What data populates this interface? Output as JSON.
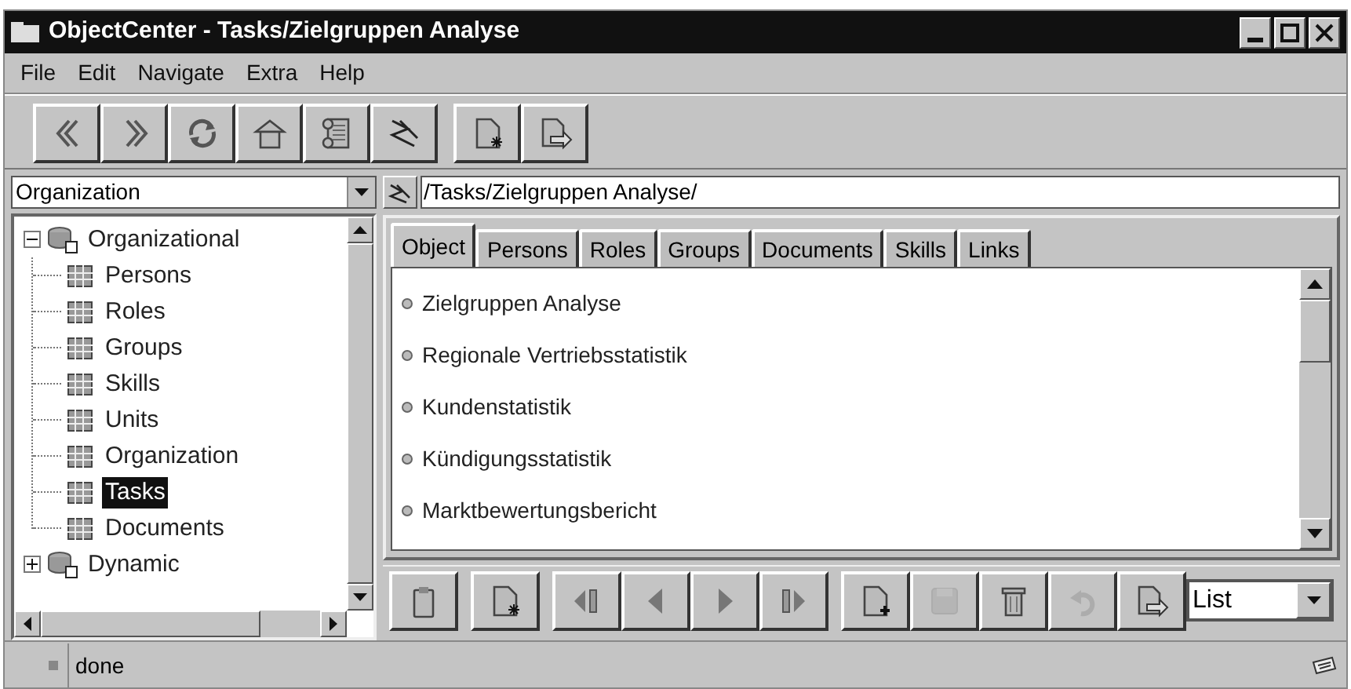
{
  "window": {
    "title": "ObjectCenter  - Tasks/Zielgruppen Analyse"
  },
  "menu": [
    "File",
    "Edit",
    "Navigate",
    "Extra",
    "Help"
  ],
  "toolbar": [
    {
      "kind": "back"
    },
    {
      "kind": "forward"
    },
    {
      "kind": "refresh"
    },
    {
      "kind": "home"
    },
    {
      "kind": "scroll"
    },
    {
      "kind": "path"
    },
    {
      "kind": "new"
    },
    {
      "kind": "export"
    }
  ],
  "location": {
    "value": "Organization"
  },
  "tree": [
    {
      "label": "Organizational",
      "kind": "group",
      "expanded": true,
      "selected": false,
      "children": [
        {
          "label": "Persons",
          "kind": "table",
          "selected": false
        },
        {
          "label": "Roles",
          "kind": "table",
          "selected": false
        },
        {
          "label": "Groups",
          "kind": "table",
          "selected": false
        },
        {
          "label": "Skills",
          "kind": "table",
          "selected": false
        },
        {
          "label": "Units",
          "kind": "table",
          "selected": false
        },
        {
          "label": "Organization",
          "kind": "table",
          "selected": false
        },
        {
          "label": "Tasks",
          "kind": "table",
          "selected": true
        },
        {
          "label": "Documents",
          "kind": "table",
          "selected": false
        }
      ]
    },
    {
      "label": "Dynamic",
      "kind": "group",
      "expanded": false,
      "selected": false
    }
  ],
  "path": {
    "value": "/Tasks/Zielgruppen Analyse/"
  },
  "tabs": [
    {
      "label": "Object",
      "selected": true
    },
    {
      "label": "Persons",
      "selected": false
    },
    {
      "label": "Roles",
      "selected": false
    },
    {
      "label": "Groups",
      "selected": false
    },
    {
      "label": "Documents",
      "selected": false
    },
    {
      "label": "Skills",
      "selected": false
    },
    {
      "label": "Links",
      "selected": false
    }
  ],
  "items": [
    "Zielgruppen Analyse",
    "Regionale Vertriebsstatistik",
    "Kundenstatistik",
    "Kündigungsstatistik",
    "Marktbewertungsbericht"
  ],
  "bottom_toolbar": [
    {
      "kind": "clipboard",
      "disabled": false
    },
    {
      "kind": "new",
      "disabled": false
    },
    {
      "kind": "first",
      "disabled": false
    },
    {
      "kind": "previous",
      "disabled": false
    },
    {
      "kind": "next",
      "disabled": false
    },
    {
      "kind": "last",
      "disabled": false
    },
    {
      "kind": "add",
      "disabled": false
    },
    {
      "kind": "save",
      "disabled": true
    },
    {
      "kind": "delete",
      "disabled": false
    },
    {
      "kind": "undo",
      "disabled": true
    },
    {
      "kind": "export",
      "disabled": false
    }
  ],
  "view": {
    "value": "List"
  },
  "status_bar": {
    "text": "done"
  }
}
